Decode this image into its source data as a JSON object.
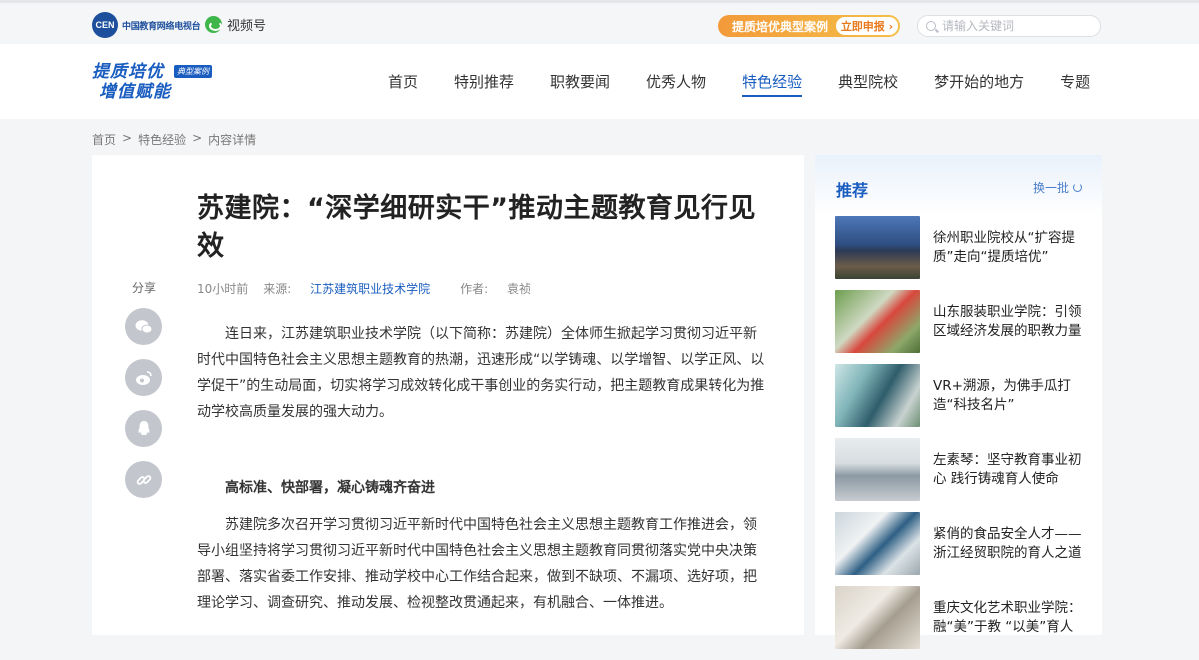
{
  "topbar": {
    "logo_mark": "CEN",
    "logo_text": "中国教育网络电视台",
    "video_label": "视频号",
    "promo_text": "提质培优典型案例",
    "promo_button": "立即申报 ›",
    "search_placeholder": "请输入关键词"
  },
  "header": {
    "brand_line1": "提质培优",
    "brand_line2": "增值赋能",
    "brand_tag": "典型案例",
    "nav": [
      "首页",
      "特别推荐",
      "职教要闻",
      "优秀人物",
      "特色经验",
      "典型院校",
      "梦开始的地方",
      "专题"
    ],
    "active_nav": "特色经验"
  },
  "breadcrumb": [
    "首页",
    ">",
    "特色经验",
    ">",
    "内容详情"
  ],
  "article": {
    "share_label": "分享",
    "title": "苏建院：“深学细研实干”推动主题教育见行见效",
    "time": "10小时前",
    "source_label": "来源:",
    "source": "江苏建筑职业技术学院",
    "author_label": "作者:",
    "author": "袁祯",
    "para1": "连日来，江苏建筑职业技术学院（以下简称：苏建院）全体师生掀起学习贯彻习近平新时代中国特色社会主义思想主题教育的热潮，迅速形成“以学铸魂、以学增智、以学正风、以学促干”的生动局面，切实将学习成效转化成干事创业的务实行动，把主题教育成果转化为推动学校高质量发展的强大动力。",
    "subhead": "高标准、快部署，凝心铸魂齐奋进",
    "para2": "苏建院多次召开学习贯彻习近平新时代中国特色社会主义思想主题教育工作推进会，领导小组坚持将学习贯彻习近平新时代中国特色社会主义思想主题教育同贯彻落实党中央决策部署、落实省委工作安排、推动学校中心工作结合起来，做到不缺项、不漏项、选好项，把理论学习、调查研究、推动发展、检视整改贯通起来，有机融合、一体推进。"
  },
  "sidebar": {
    "heading": "推荐",
    "refresh": "换一批",
    "items": [
      {
        "title": "徐州职业院校从“扩容提质”走向“提质培优”"
      },
      {
        "title": "山东服装职业学院：引领区域经济发展的职教力量"
      },
      {
        "title": "VR+溯源，为佛手瓜打造“科技名片”"
      },
      {
        "title": "左素琴：坚守教育事业初心 践行铸魂育人使命"
      },
      {
        "title": "紧俏的食品安全人才——浙江经贸职院的育人之道"
      },
      {
        "title": "重庆文化艺术职业学院：融“美”于教 “以美”育人"
      }
    ]
  }
}
